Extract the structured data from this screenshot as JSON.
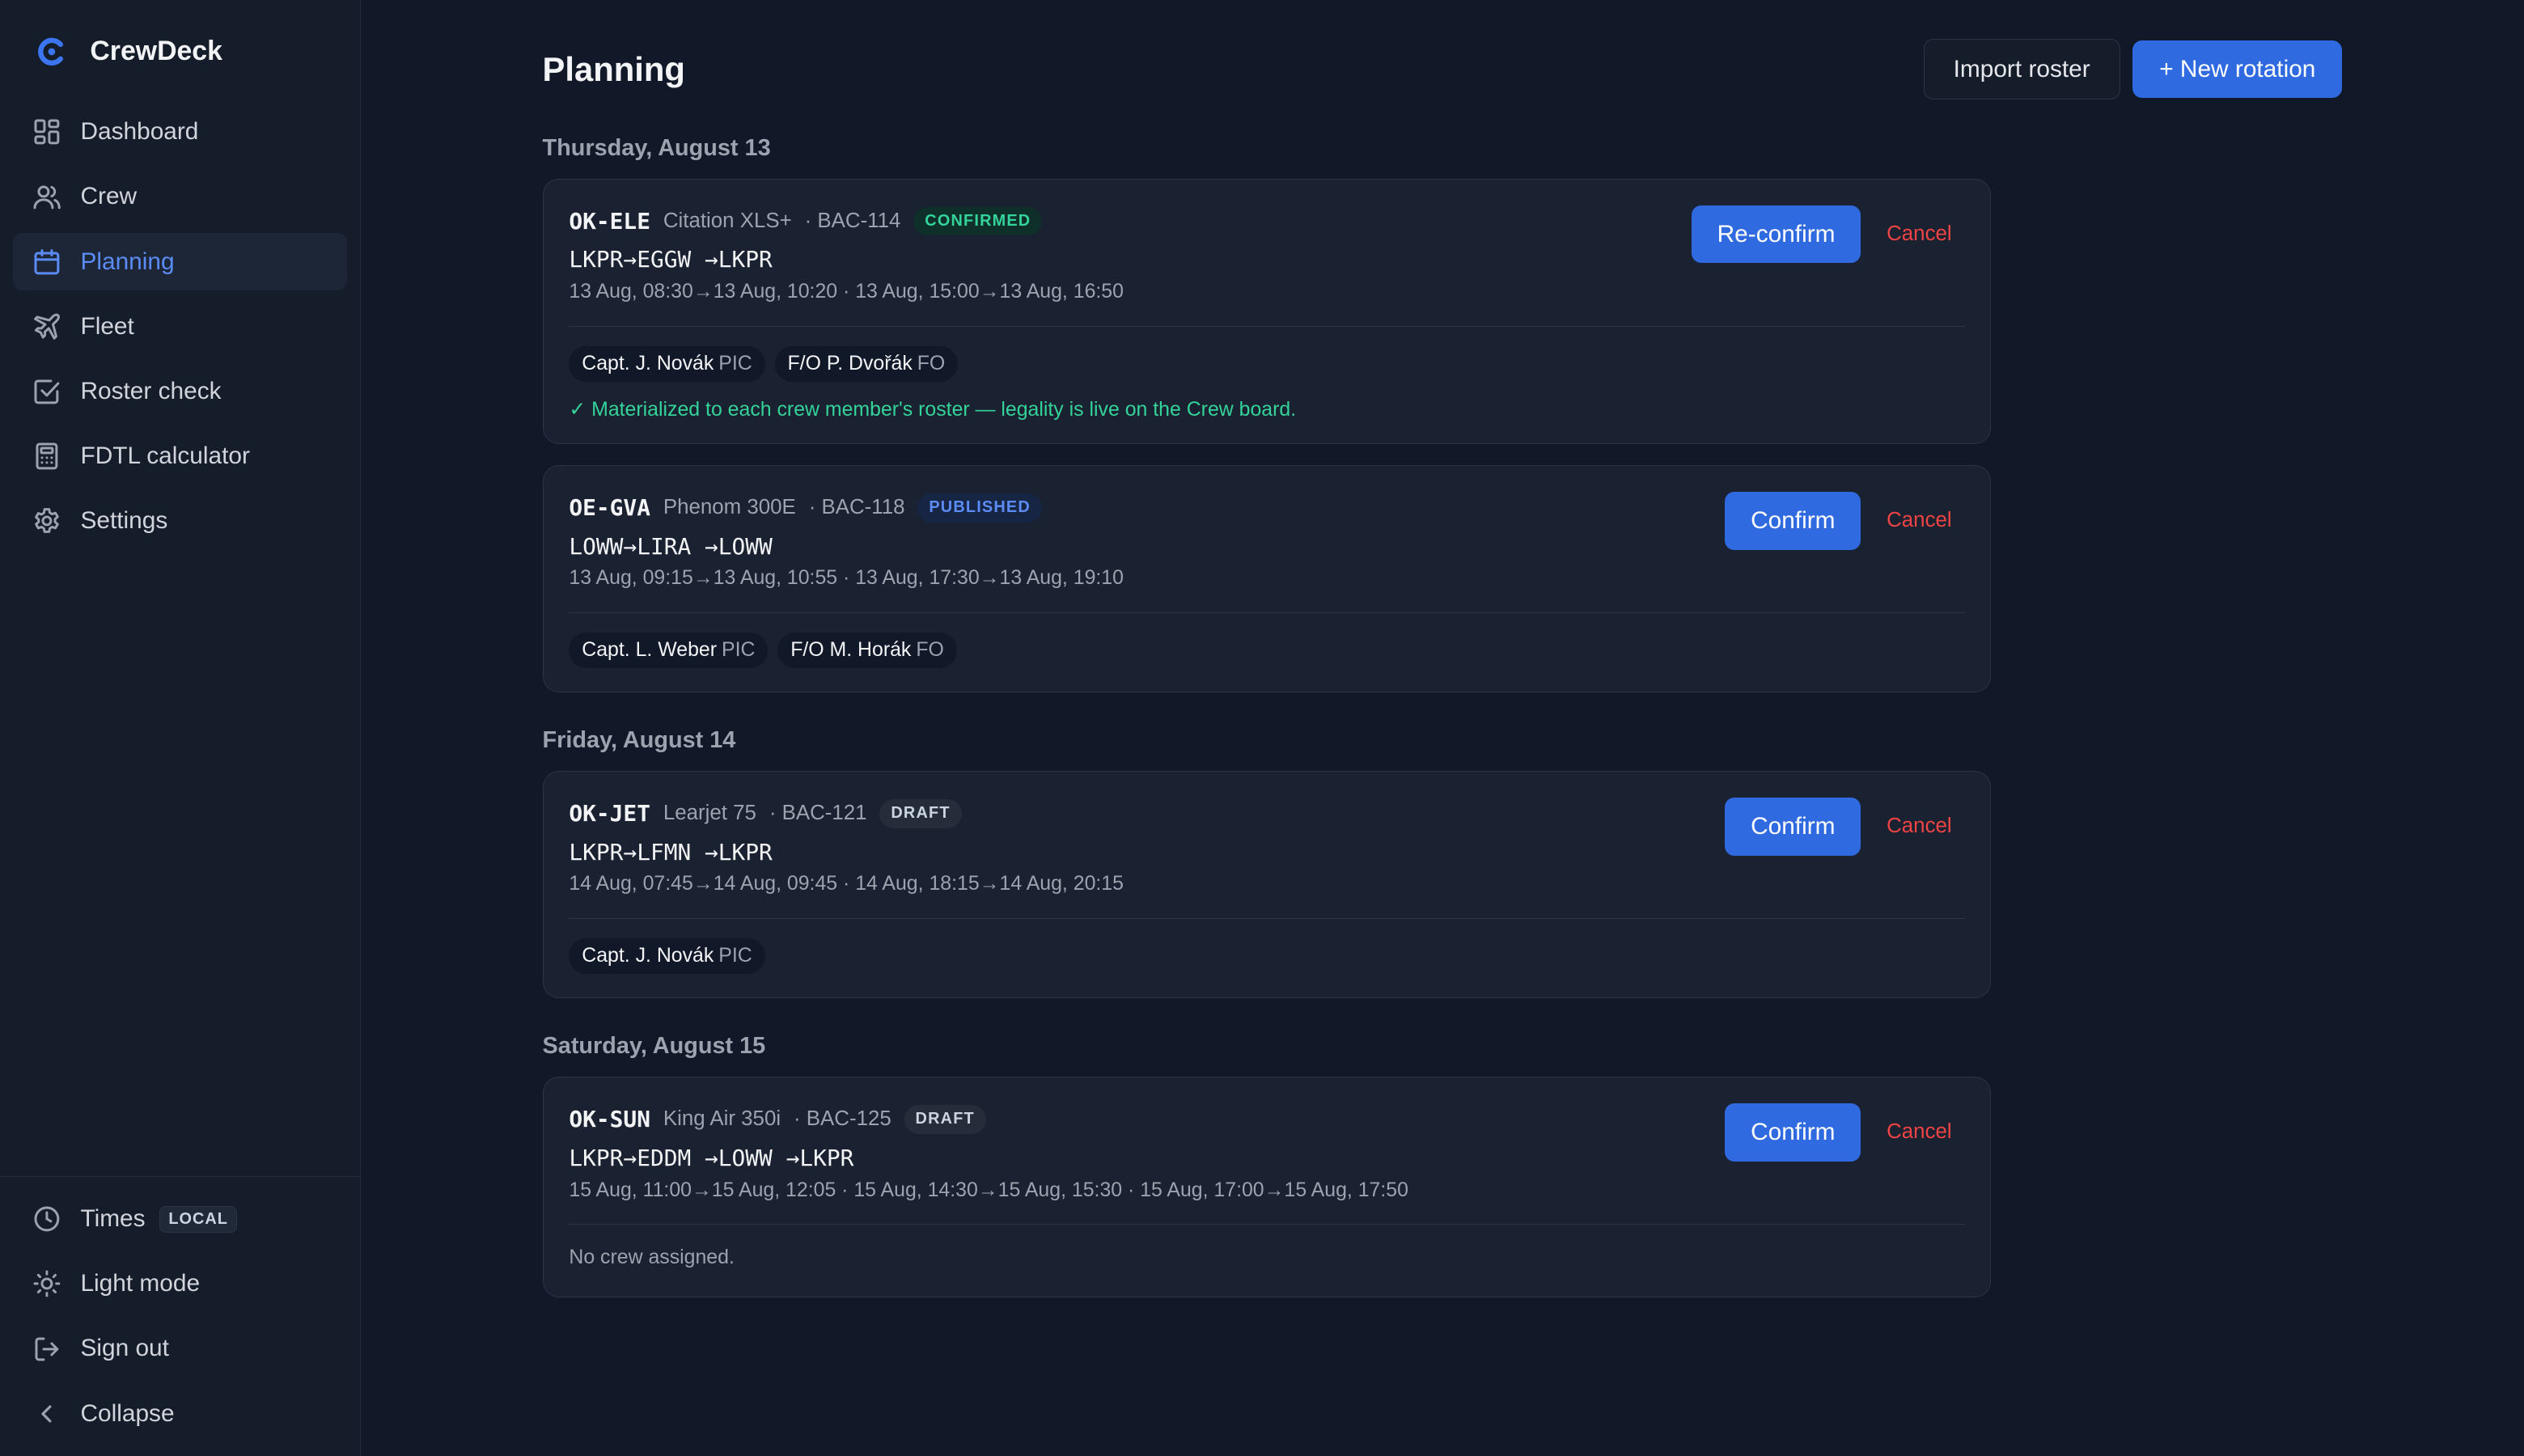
{
  "app": {
    "name": "CrewDeck"
  },
  "sidebar": {
    "items": [
      {
        "label": "Dashboard",
        "icon": "dashboard-icon",
        "active": false
      },
      {
        "label": "Crew",
        "icon": "users-icon",
        "active": false
      },
      {
        "label": "Planning",
        "icon": "calendar-icon",
        "active": true
      },
      {
        "label": "Fleet",
        "icon": "plane-icon",
        "active": false
      },
      {
        "label": "Roster check",
        "icon": "checkbox-icon",
        "active": false
      },
      {
        "label": "FDTL calculator",
        "icon": "calculator-icon",
        "active": false
      },
      {
        "label": "Settings",
        "icon": "gear-icon",
        "active": false
      }
    ],
    "bottom": {
      "times_label": "Times",
      "times_badge": "LOCAL",
      "theme_label": "Light mode",
      "signout_label": "Sign out",
      "collapse_label": "Collapse"
    }
  },
  "header": {
    "title": "Planning",
    "import_label": "Import roster",
    "new_label": "+ New rotation"
  },
  "days": [
    {
      "heading": "Thursday, August 13"
    },
    {
      "heading": "Friday, August 14"
    },
    {
      "heading": "Saturday, August 15"
    }
  ],
  "rotations": [
    {
      "tail": "OK-ELE",
      "aircraft": "Citation XLS+",
      "trip": "· BAC-114",
      "status": "CONFIRMED",
      "route": "LKPR→EGGW →LKPR",
      "times": "13 Aug, 08:30→13 Aug, 10:20 · 13 Aug, 15:00→13 Aug, 16:50",
      "action_label": "Re-confirm",
      "cancel_label": "Cancel",
      "crew": [
        {
          "name": "Capt. J. Novák",
          "role": "PIC"
        },
        {
          "name": "F/O P. Dvořák",
          "role": "FO"
        }
      ],
      "note": "✓ Materialized to each crew member's roster — legality is live on the Crew board."
    },
    {
      "tail": "OE-GVA",
      "aircraft": "Phenom 300E",
      "trip": "· BAC-118",
      "status": "PUBLISHED",
      "route": "LOWW→LIRA →LOWW",
      "times": "13 Aug, 09:15→13 Aug, 10:55 · 13 Aug, 17:30→13 Aug, 19:10",
      "action_label": "Confirm",
      "cancel_label": "Cancel",
      "crew": [
        {
          "name": "Capt. L. Weber",
          "role": "PIC"
        },
        {
          "name": "F/O M. Horák",
          "role": "FO"
        }
      ]
    },
    {
      "tail": "OK-JET",
      "aircraft": "Learjet 75",
      "trip": "· BAC-121",
      "status": "DRAFT",
      "route": "LKPR→LFMN →LKPR",
      "times": "14 Aug, 07:45→14 Aug, 09:45 · 14 Aug, 18:15→14 Aug, 20:15",
      "action_label": "Confirm",
      "cancel_label": "Cancel",
      "crew": [
        {
          "name": "Capt. J. Novák",
          "role": "PIC"
        }
      ]
    },
    {
      "tail": "OK-SUN",
      "aircraft": "King Air 350i",
      "trip": "· BAC-125",
      "status": "DRAFT",
      "route": "LKPR→EDDM →LOWW →LKPR",
      "times": "15 Aug, 11:00→15 Aug, 12:05 · 15 Aug, 14:30→15 Aug, 15:30 · 15 Aug, 17:00→15 Aug, 17:50",
      "action_label": "Confirm",
      "cancel_label": "Cancel",
      "crew": [],
      "empty_crew": "No crew assigned."
    }
  ],
  "colors": {
    "background": "#111827",
    "sidebar": "#151c2a",
    "card": "#1a2130",
    "accent": "#2f6ae0",
    "confirmed": "#34d399",
    "published": "#5b8cf5",
    "danger": "#ef4444"
  }
}
